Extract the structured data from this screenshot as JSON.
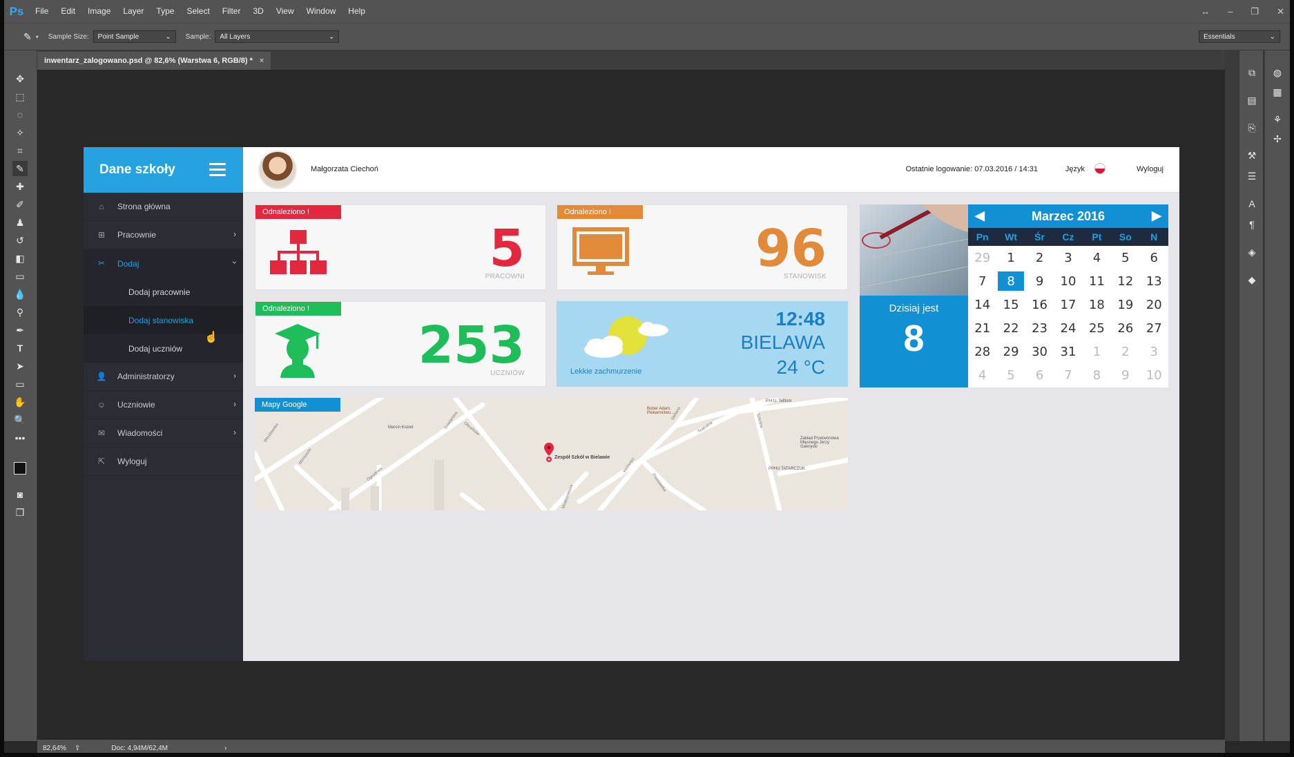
{
  "app": {
    "logo": "Ps"
  },
  "menu": [
    "File",
    "Edit",
    "Image",
    "Layer",
    "Type",
    "Select",
    "Filter",
    "3D",
    "View",
    "Window",
    "Help"
  ],
  "options": {
    "sample_size_label": "Sample Size:",
    "sample_size_value": "Point Sample",
    "sample_label": "Sample:",
    "sample_value": "All Layers",
    "workspace": "Essentials"
  },
  "document_tab": {
    "title": "inwentarz_zalogowano.psd @ 82,6% (Warstwa 6, RGB/8) *",
    "close": "×"
  },
  "status": {
    "zoom": "82,64%",
    "doc": "Doc: 4,94M/62,4M"
  },
  "site": {
    "brand": "Dane szkoły",
    "user_name": "Małgorzata Ciechoń",
    "last_login": "Ostatnie logowanie: 07.03.2016 / 14:31",
    "language_label": "Język",
    "logout": "Wyloguj",
    "nav": [
      {
        "label": "Strona główna",
        "icon": "home-icon"
      },
      {
        "label": "Pracownie",
        "icon": "sitemap-icon"
      },
      {
        "label": "Dodaj",
        "icon": "tools-icon"
      },
      {
        "label": "Administratorzy",
        "icon": "user-icon"
      },
      {
        "label": "Uczniowie",
        "icon": "smile-icon"
      },
      {
        "label": "Wiadomości",
        "icon": "inbox-icon"
      },
      {
        "label": "Wyloguj",
        "icon": "external-link-icon"
      }
    ],
    "sub_nav": [
      "Dodaj pracownie",
      "Dodaj stanowiska",
      "Dodaj uczniów"
    ],
    "cards": [
      {
        "tag": "Odnaleziono !",
        "value": "5",
        "label": "PRACOWNI",
        "color": "#e2283e"
      },
      {
        "tag": "Odnaleziono !",
        "value": "96",
        "label": "STANOWISK",
        "color": "#e08a3a"
      },
      {
        "tag": "Odnaleziono !",
        "value": "253",
        "label": "UCZNIÓW",
        "color": "#1ebd5a"
      }
    ],
    "weather": {
      "time": "12:48",
      "city": "BIELAWA",
      "temp": "24 °C",
      "desc": "Lekkie zachmurzenie"
    },
    "today": {
      "label": "Dzisiaj jest",
      "day": "8"
    },
    "calendar": {
      "title": "Marzec 2016",
      "weekdays": [
        "Pn",
        "Wt",
        "Śr",
        "Cz",
        "Pt",
        "So",
        "N"
      ],
      "days": [
        "29",
        "1",
        "2",
        "3",
        "4",
        "5",
        "6",
        "7",
        "8",
        "9",
        "10",
        "11",
        "12",
        "13",
        "14",
        "15",
        "16",
        "17",
        "18",
        "19",
        "20",
        "21",
        "22",
        "23",
        "24",
        "25",
        "26",
        "27",
        "28",
        "29",
        "30",
        "31",
        "1",
        "2",
        "3",
        "4",
        "5",
        "6",
        "7",
        "8",
        "9",
        "10"
      ]
    },
    "map": {
      "tag": "Mapy Google",
      "marker": "Zespół Szkół w Bielawie",
      "labels": [
        "Marcin Kozieł",
        "Bober Adam. Piekarnictwo...",
        "P.H.U. Telltom",
        "Zakład Przetwórstwa Mięsnego Jerzy Gawrycki",
        "PPHU TATARCZUK",
        "Wrocławska",
        "Moniuszki",
        "Obrońców",
        "Szkolna",
        "Stefana",
        "Wolności",
        "Piastowska",
        "Teatralna",
        "Sowiańska",
        "Ogrodowa",
        "Modrzewiowa"
      ]
    }
  }
}
